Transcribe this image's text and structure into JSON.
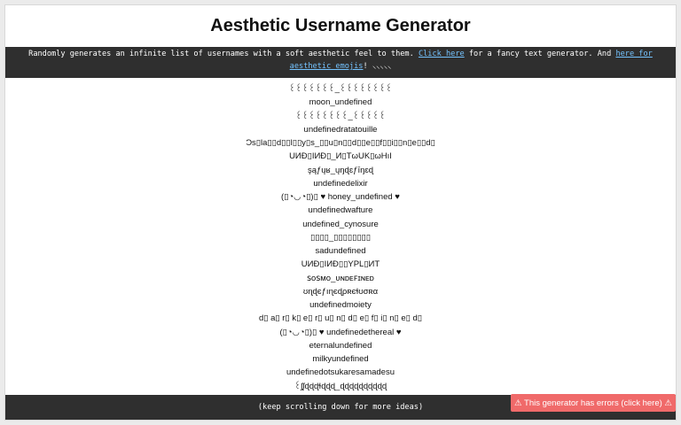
{
  "header": {
    "title": "Aesthetic Username Generator"
  },
  "intro": {
    "text_before": "Randomly generates an infinite list of usernames with a soft aesthetic feel to them. ",
    "link1_label": "Click here",
    "text_middle": " for a fancy text generator. And ",
    "link2_label": "here for aesthetic emojis",
    "text_after": "! ⸜⸜⸜⸜⸜"
  },
  "usernames": [
    "꒰꒰꒰꒰꒰꒰꒰_꒰꒰꒰꒰꒰꒰꒰꒰",
    "moon_undefined",
    "꒰꒰꒰꒰꒰꒰꒰꒰_꒰꒰꒰꒰꒰",
    "undefinedratatouille",
    "Ɔs▯la▯▯d▯▯l▯▯y▯s_▯▯u▯n▯▯d▯▯e▯▯f▯▯i▯▯n▯e▯▯d▯",
    "UИĐ▯IИĐ▯_И▯TωUK▯ωHıI",
    "şąƒųʁ_ųŋɖɛƒīŋɛɖ",
    "undefinedelixir",
    "(▯◔◡◔▯)▯ ♥ honey_undefined ♥",
    "undefinedwafture",
    "undefined_cynosure",
    "▯▯▯▯_▯▯▯▯▯▯▯▯",
    "sadundefined",
    "UИĐ▯IИĐ▯▯YPL▯ИT",
    "ꜱᴏꜱᴍᴏ_ᴜɴᴅᴇꜰɪɴᴇᴅ",
    "ʊɳɖєƒıɳєɖρʀєɬʊσʀα",
    "undefinedmoiety",
    "d▯  a▯  r▯  k▯  e▯  r▯  u▯  n▯  d▯  e▯  f▯  i▯  n▯  e▯  d▯",
    "(▯◔◡◔▯)▯ ♥ undefinedethereal ♥",
    "eternalundefined",
    "milkyundefined",
    "undefinedotsukaresamadesu",
    "꒰ʃᶘɖɖɖɬɖɖɖ_ɖɖɖɖɖɖɖɖɖɖ"
  ],
  "footer": {
    "text": "(keep scrolling down for more ideas)"
  },
  "error_button": {
    "label": "⚠ This generator has errors (click here) ⚠"
  },
  "colors": {
    "dark_bar": "#2f2f2f",
    "link": "#74c3ff",
    "error": "#f06a6a"
  }
}
